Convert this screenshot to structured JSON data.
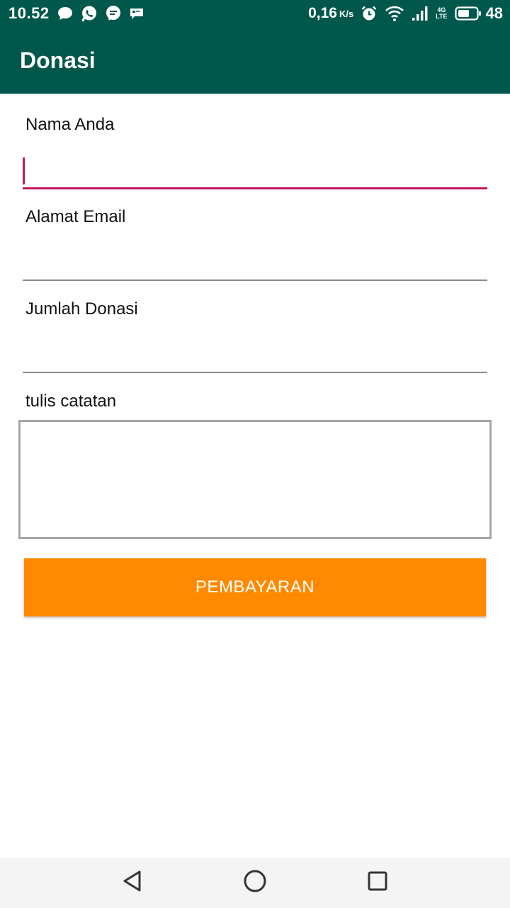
{
  "status_bar": {
    "time": "10.52",
    "notification_icons": [
      "chat-bubble-icon",
      "whatsapp-icon",
      "message-icon",
      "sim-card-icon"
    ],
    "network_speed": "0,16",
    "network_speed_unit": "K/s",
    "network_type_top": "4G",
    "network_type_bottom": "LTE",
    "battery_level": "48"
  },
  "app_bar": {
    "title": "Donasi"
  },
  "form": {
    "name": {
      "label": "Nama Anda",
      "value": ""
    },
    "email": {
      "label": "Alamat Email",
      "value": ""
    },
    "amount": {
      "label": "Jumlah Donasi",
      "value": ""
    },
    "notes": {
      "label": "tulis catatan",
      "value": ""
    },
    "submit_label": "PEMBAYARAN"
  },
  "colors": {
    "primary": "#00574b",
    "accent": "#c2185b",
    "button": "#ff8a00"
  },
  "nav_bar": {
    "buttons": [
      "back-icon",
      "home-icon",
      "recents-icon"
    ]
  }
}
